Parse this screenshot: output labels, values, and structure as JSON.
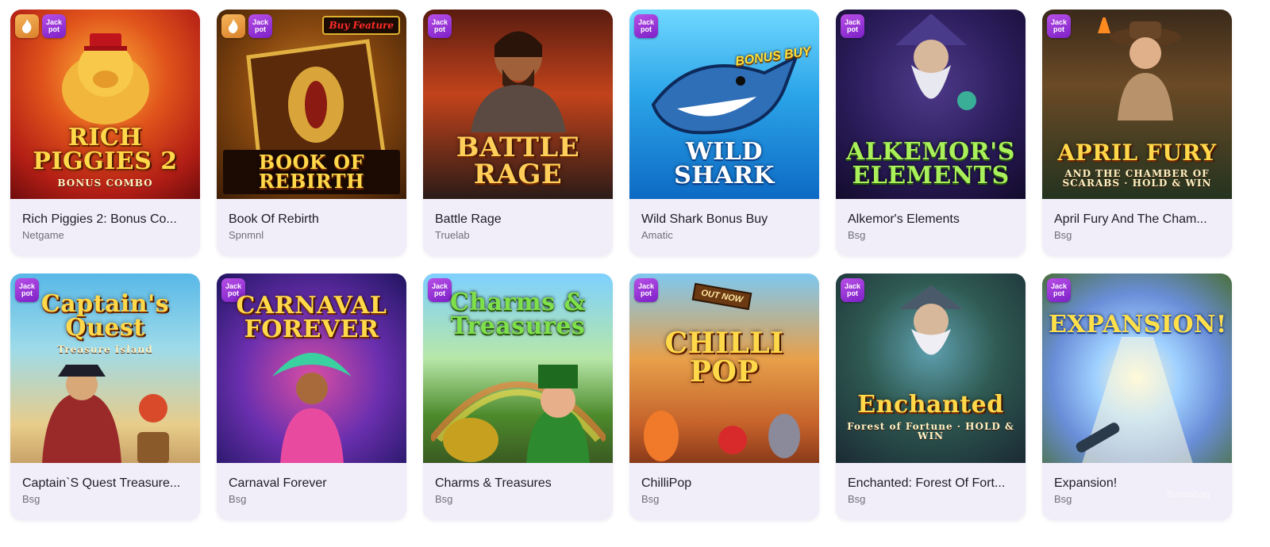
{
  "games": [
    {
      "title": "Rich Piggies 2: Bonus Co...",
      "provider": "Netgame",
      "logo": "RICH PIGGIES 2",
      "logo_sub": "BONUS COMBO",
      "badge": "Jack pot",
      "hot": true
    },
    {
      "title": "Book Of Rebirth",
      "provider": "Spnmnl",
      "logo": "BOOK OF REBIRTH",
      "logo_sub": "",
      "badge": "Jack pot",
      "hot": true,
      "tag": "Buy Feature"
    },
    {
      "title": "Battle Rage",
      "provider": "Truelab",
      "logo": "BATTLE RAGE",
      "logo_sub": "",
      "badge": "Jack pot",
      "hot": false
    },
    {
      "title": "Wild Shark Bonus Buy",
      "provider": "Amatic",
      "logo": "WILD SHARK",
      "logo_sub": "",
      "badge": "Jack pot",
      "hot": false,
      "tag": "BONUS BUY"
    },
    {
      "title": "Alkemor's Elements",
      "provider": "Bsg",
      "logo": "ALKEMOR'S ELEMENTS",
      "logo_sub": "",
      "badge": "Jack pot",
      "hot": false
    },
    {
      "title": "April Fury And The Cham...",
      "provider": "Bsg",
      "logo": "APRIL FURY",
      "logo_sub": "AND THE CHAMBER OF SCARABS · HOLD & WIN",
      "badge": "Jack pot",
      "hot": false
    },
    {
      "title": "Captain`S Quest Treasure...",
      "provider": "Bsg",
      "logo": "Captain's Quest",
      "logo_sub": "Treasure Island",
      "badge": "Jack pot",
      "hot": false
    },
    {
      "title": "Carnaval Forever",
      "provider": "Bsg",
      "logo": "CARNAVAL FOREVER",
      "logo_sub": "",
      "badge": "Jack pot",
      "hot": false
    },
    {
      "title": "Charms & Treasures",
      "provider": "Bsg",
      "logo": "Charms & Treasures",
      "logo_sub": "",
      "badge": "Jack pot",
      "hot": false
    },
    {
      "title": "ChilliPop",
      "provider": "Bsg",
      "logo": "CHILLI POP",
      "logo_sub": "",
      "badge": "Jack pot",
      "hot": false,
      "tag": "OUT NOW"
    },
    {
      "title": "Enchanted: Forest Of Fort...",
      "provider": "Bsg",
      "logo": "Enchanted",
      "logo_sub": "Forest of Fortune · HOLD & WIN",
      "badge": "Jack pot",
      "hot": false
    },
    {
      "title": "Expansion!",
      "provider": "Bsg",
      "logo": "EXPANSION!",
      "logo_sub": "",
      "badge": "Jack pot",
      "hot": false
    }
  ],
  "watermark": "Bonusbag",
  "colors": {
    "card_bg": "#f2eef9",
    "jackpot_badge": "#9a36d8",
    "hot_badge": "#e6962f",
    "title_text": "#1c1c28",
    "provider_text": "#6e6e7c"
  },
  "icons": {
    "hot": "fire-icon",
    "jackpot": "jackpot-badge"
  }
}
